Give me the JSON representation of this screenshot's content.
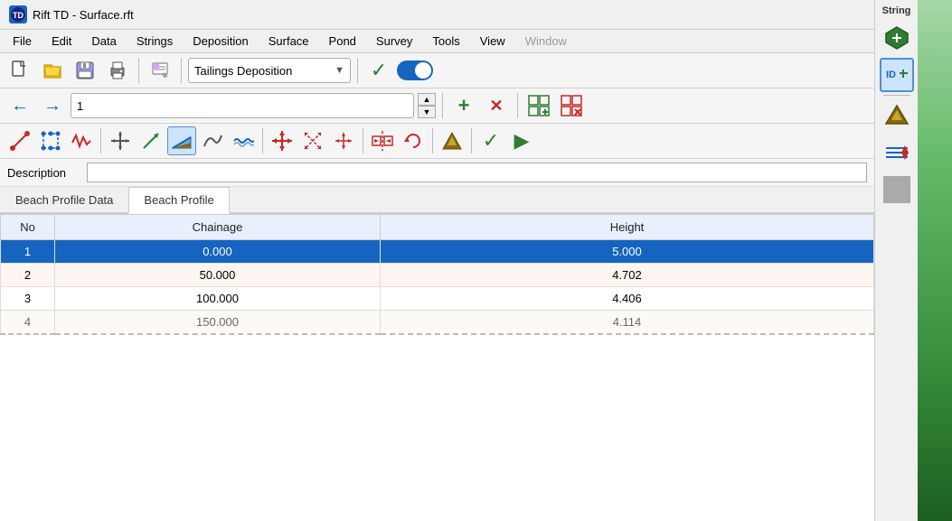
{
  "titleBar": {
    "icon": "TD",
    "title": "Rift TD - Surface.rft"
  },
  "menuBar": {
    "items": [
      "File",
      "Edit",
      "Data",
      "Strings",
      "Deposition",
      "Surface",
      "Pond",
      "Survey",
      "Tools",
      "View",
      "Window"
    ]
  },
  "toolbar1": {
    "dropdown": {
      "value": "Tailings Deposition",
      "options": [
        "Tailings Deposition"
      ]
    },
    "checkLabel": "✓",
    "toggleState": "on",
    "stringLabel": "String"
  },
  "toolbar2": {
    "backArrow": "←",
    "forwardArrow": "→",
    "inputValue": "1",
    "spinUp": "▲",
    "spinDown": "▼",
    "addLabel": "+",
    "deleteLabel": "✕"
  },
  "descriptionRow": {
    "label": "Description",
    "placeholder": ""
  },
  "tabs": [
    {
      "id": "beach-profile-data",
      "label": "Beach Profile Data",
      "active": false
    },
    {
      "id": "beach-profile",
      "label": "Beach Profile",
      "active": true
    }
  ],
  "table": {
    "columns": [
      "No",
      "Chainage",
      "Height"
    ],
    "rows": [
      {
        "no": "1",
        "chainage": "0.000",
        "height": "5.000",
        "selected": true
      },
      {
        "no": "2",
        "chainage": "50.000",
        "height": "4.702",
        "selected": false
      },
      {
        "no": "3",
        "chainage": "100.000",
        "height": "4.406",
        "selected": false
      },
      {
        "no": "4",
        "chainage": "150.000",
        "height": "4.114",
        "selected": false,
        "partial": true
      }
    ]
  },
  "rightSidebar": {
    "buttons": [
      {
        "name": "polygon-add-icon",
        "symbol": "⬡+"
      },
      {
        "name": "id-add-icon",
        "symbol": "ID+"
      },
      {
        "name": "terrain-icon",
        "symbol": "▲"
      },
      {
        "name": "flow-icon",
        "symbol": "≋"
      },
      {
        "name": "gray-box",
        "symbol": ""
      }
    ]
  },
  "colors": {
    "accent": "#1565c0",
    "greenCheck": "#2e7d32",
    "redDelete": "#c62828",
    "selectedRow": "#1565c0",
    "tableHeaderBg": "#dce8f8",
    "tabActiveBg": "#ffffff"
  }
}
